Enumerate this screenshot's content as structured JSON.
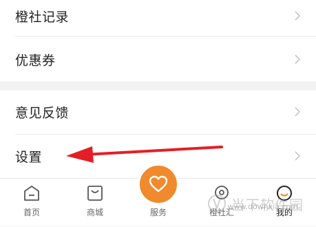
{
  "menu_top": [
    {
      "label": "橙社记录"
    },
    {
      "label": "优惠券"
    }
  ],
  "menu_mid": [
    {
      "label": "意见反馈"
    },
    {
      "label": "设置"
    }
  ],
  "tabs": [
    {
      "label": "首页",
      "icon": "home-icon"
    },
    {
      "label": "商城",
      "icon": "shop-icon"
    },
    {
      "label": "服务",
      "icon": "heart-icon"
    },
    {
      "label": "橙社汇",
      "icon": "community-icon"
    },
    {
      "label": "我的",
      "icon": "profile-icon"
    }
  ],
  "watermark": {
    "name": "当下软件园",
    "url": "www.downxia.com"
  },
  "colors": {
    "accent": "#f08a2c",
    "arrow": "#e31e24"
  }
}
